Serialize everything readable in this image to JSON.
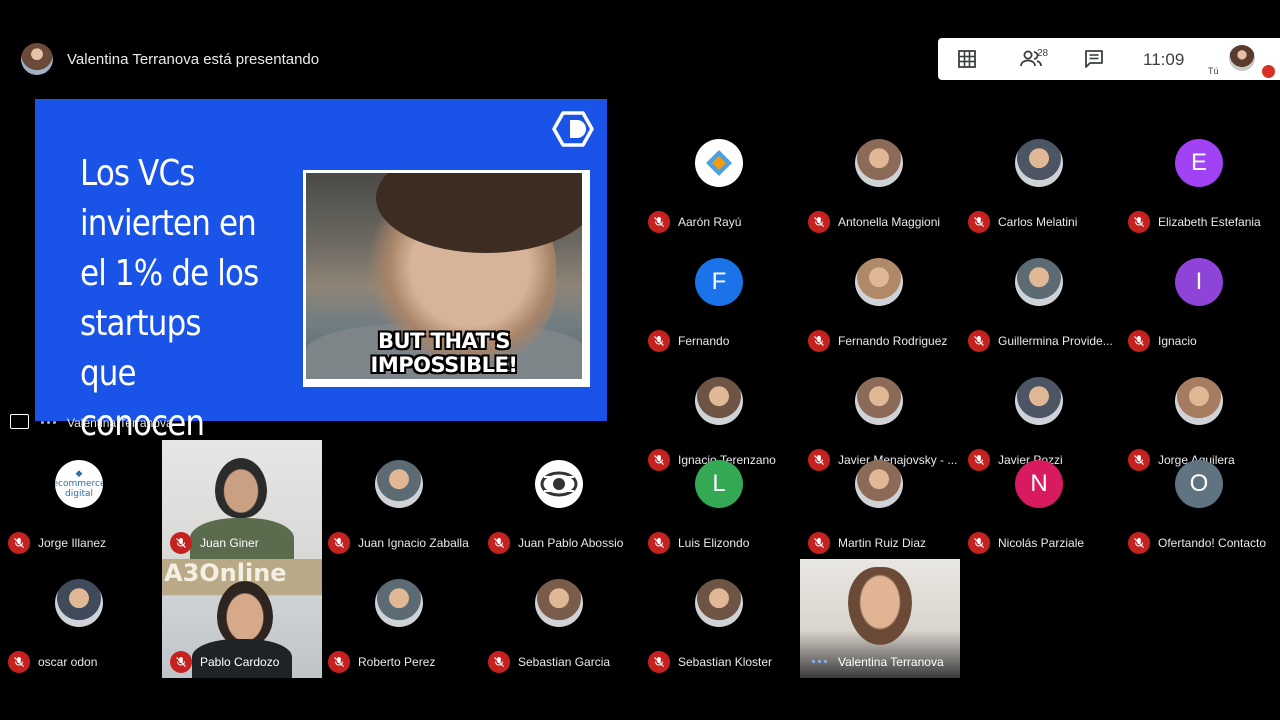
{
  "header": {
    "presenting_text": "Valentina Terranova está presentando"
  },
  "controls": {
    "grid_icon": "grid-icon",
    "people_count": "28",
    "chat_icon": "chat-icon",
    "time": "11:09",
    "self_label": "Tú"
  },
  "presentation": {
    "slide_title": "Los VCs\ninvierten en\nel 1% de los\nstartups que\nconocen",
    "meme_caption": "BUT THAT'S IMPOSSIBLE!",
    "presenter_name": "Valentina Terranova"
  },
  "participants": [
    {
      "name": "Aarón Rayú",
      "avatar": "logo"
    },
    {
      "name": "Antonella Maggioni",
      "avatar": "photo"
    },
    {
      "name": "Carlos Melatini",
      "avatar": "photo"
    },
    {
      "name": "Elizabeth Estefania",
      "avatar": "letter",
      "letter": "E",
      "color": "#a142f4"
    },
    {
      "name": "Fernando",
      "avatar": "letter",
      "letter": "F",
      "color": "#1a73e8"
    },
    {
      "name": "Fernando Rodriguez",
      "avatar": "photo"
    },
    {
      "name": "Guillermina Provide...",
      "avatar": "photo"
    },
    {
      "name": "Ignacio",
      "avatar": "letter",
      "letter": "I",
      "color": "#8e44d6"
    },
    {
      "name": "Ignacio Terenzano",
      "avatar": "photo"
    },
    {
      "name": "Javier Menajovsky - ...",
      "avatar": "photo"
    },
    {
      "name": "Javier Pozzi",
      "avatar": "photo"
    },
    {
      "name": "Jorge Aguilera",
      "avatar": "photo"
    },
    {
      "name": "Jorge Illanez",
      "avatar": "logo"
    },
    {
      "name": "Juan Giner",
      "avatar": "video"
    },
    {
      "name": "Juan Ignacio Zaballa",
      "avatar": "photo"
    },
    {
      "name": "Juan Pablo Abossio",
      "avatar": "logo"
    },
    {
      "name": "Luis Elizondo",
      "avatar": "letter",
      "letter": "L",
      "color": "#34a853"
    },
    {
      "name": "Martin Ruiz Diaz",
      "avatar": "photo"
    },
    {
      "name": "Nicolás Parziale",
      "avatar": "letter",
      "letter": "N",
      "color": "#d81b60"
    },
    {
      "name": "Ofertando! Contacto",
      "avatar": "letter",
      "letter": "O",
      "color": "#5f7480"
    },
    {
      "name": "oscar odon",
      "avatar": "photo"
    },
    {
      "name": "Pablo Cardozo",
      "avatar": "video",
      "video_text": "A3Online"
    },
    {
      "name": "Roberto Perez",
      "avatar": "photo"
    },
    {
      "name": "Sebastian Garcia",
      "avatar": "photo"
    },
    {
      "name": "Sebastian Kloster",
      "avatar": "photo"
    },
    {
      "name": "Valentina Terranova",
      "avatar": "video"
    }
  ],
  "colors": {
    "background": "#000000",
    "slide_blue": "#1a53e8",
    "muted_red": "#c5221f",
    "speaking_dots": "#8ab4f8"
  }
}
